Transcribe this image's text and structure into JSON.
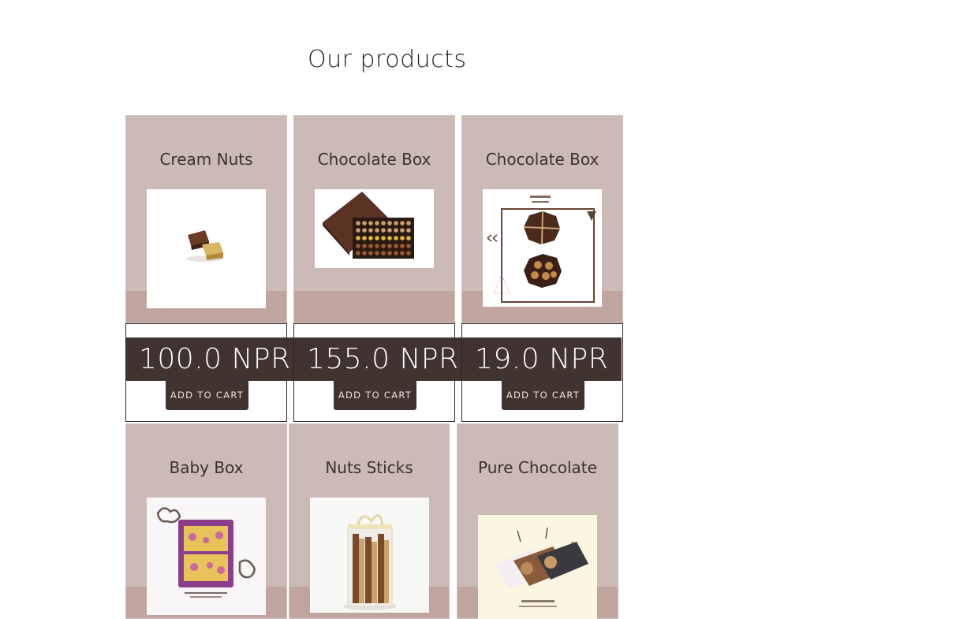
{
  "page": {
    "title": "Our products"
  },
  "colors": {
    "card_background": "#cbbab5",
    "card_band": "#bfa59d",
    "price_background": "#413330",
    "text_dark": "#3e302b"
  },
  "products": [
    {
      "name": "Cream Nuts",
      "price": "100.0 NPR",
      "cta": "ADD TO CART",
      "image": "cream-nuts-image"
    },
    {
      "name": "Chocolate Box",
      "price": "155.0 NPR",
      "cta": "ADD TO CART",
      "image": "chocolate-box-image"
    },
    {
      "name": "Chocolate Box",
      "price": "19.0 NPR",
      "cta": "ADD TO CART",
      "image": "chocoline-box-image"
    },
    {
      "name": "Baby Box",
      "image": "baby-box-image"
    },
    {
      "name": "Nuts Sticks",
      "image": "nuts-sticks-image"
    },
    {
      "name": "Pure Chocolate",
      "image": "pure-chocolate-image"
    }
  ]
}
